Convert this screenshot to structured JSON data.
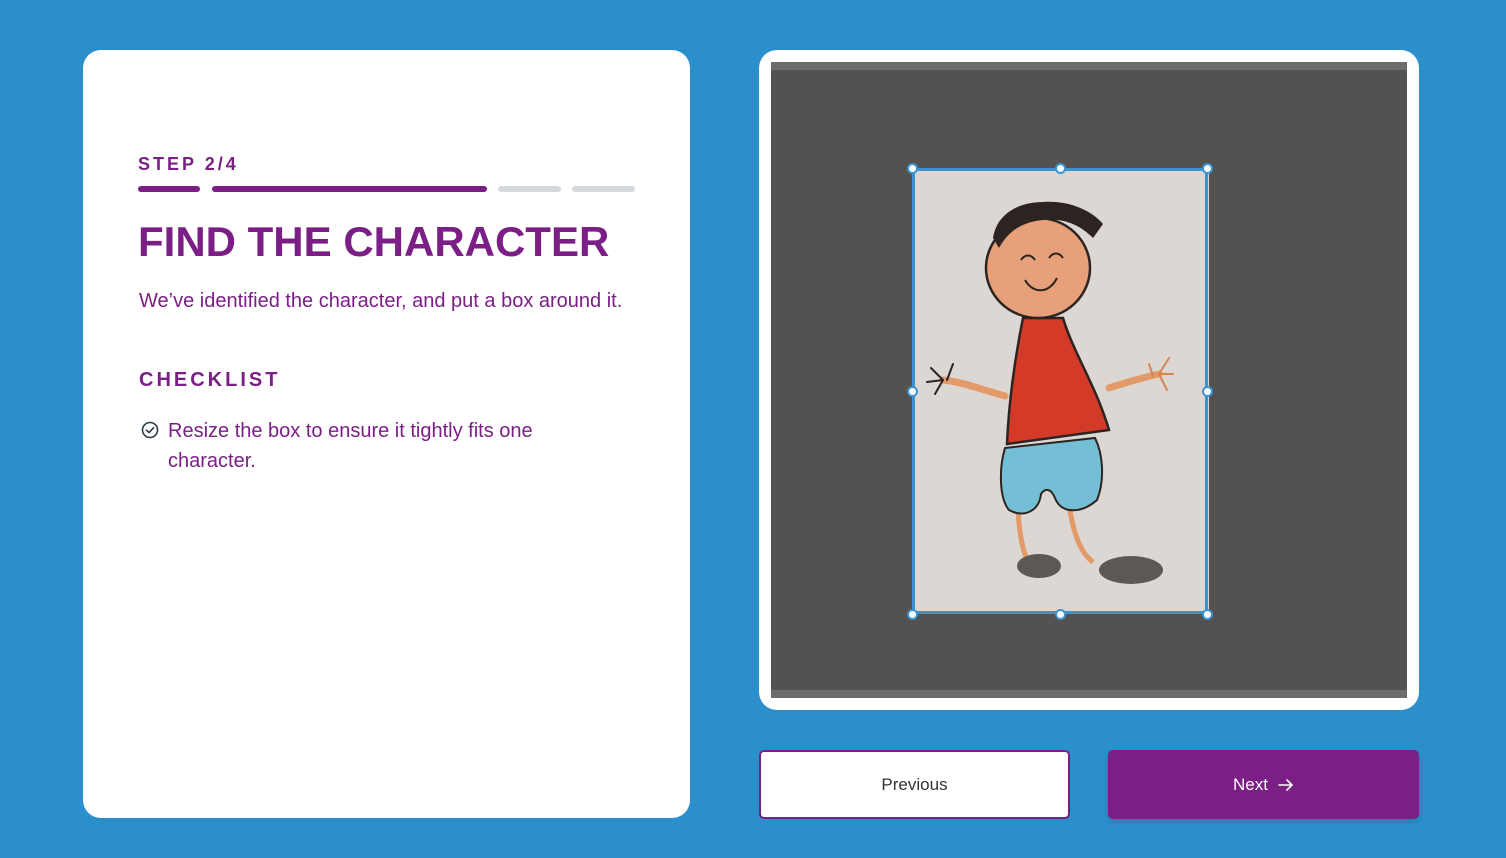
{
  "step": {
    "label": "STEP 2/4",
    "current": 2,
    "total": 4,
    "active_color": "#7b1f87",
    "inactive_color": "#d5d8dd"
  },
  "main": {
    "title": "FIND THE CHARACTER",
    "description": "We’ve identified the character, and put a box around it."
  },
  "checklist": {
    "heading": "CHECKLIST",
    "items": [
      {
        "text": "Resize the box to ensure it tightly fits one character.",
        "icon": "check-circle-icon"
      }
    ]
  },
  "canvas": {
    "image_description_icon": "child-drawing-image",
    "box_color": "#3b93d1"
  },
  "buttons": {
    "previous_label": "Previous",
    "next_label": "Next",
    "next_icon": "arrow-right-icon"
  },
  "colors": {
    "background": "#2a8fcb",
    "brand": "#7b1f87"
  }
}
